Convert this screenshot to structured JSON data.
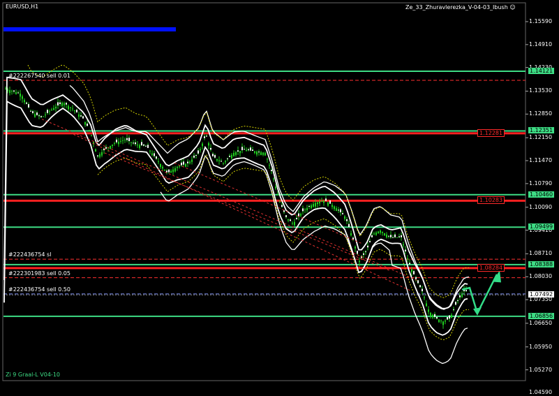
{
  "symbol": "EURUSD,H1",
  "indicator": "Ze_33_Zhuravlerezka_V-04-03_Ibush",
  "footer_label": "Zi 9 Graal-L  V04-10",
  "order_labels": [
    {
      "text": "#222267540 sell 0.01",
      "level": 1.1385
    },
    {
      "text": "#222436754 sl",
      "level": 1.0855
    },
    {
      "text": "#222301983 sell 0.05",
      "level": 1.08
    },
    {
      "text": "#222436754 sell 0.50",
      "level": 1.0752
    }
  ],
  "axis": {
    "min": 1.0495,
    "max": 1.159,
    "ticks": [
      "1.15590",
      "1.14910",
      "1.14230",
      "1.13530",
      "1.12850",
      "1.12150",
      "1.11470",
      "1.10790",
      "1.10090",
      "1.09410",
      "1.08710",
      "1.08030",
      "1.07350",
      "1.06650",
      "1.05950",
      "1.05270",
      "1.04590"
    ],
    "tick_values": [
      1.1559,
      1.1491,
      1.1423,
      1.1353,
      1.1285,
      1.1215,
      1.1147,
      1.1079,
      1.1009,
      1.0941,
      1.0871,
      1.0803,
      1.0735,
      1.0665,
      1.0595,
      1.0527,
      1.0459
    ]
  },
  "green_levels": [
    {
      "value": 1.14121,
      "label": "1.14121"
    },
    {
      "value": 1.12351,
      "label": "1.12351"
    },
    {
      "value": 1.1046,
      "label": "1.10460"
    },
    {
      "value": 1.09499,
      "label": "1.09499"
    },
    {
      "value": 1.08388,
      "label": "1.08388"
    },
    {
      "value": 1.06856,
      "label": "1.06856"
    }
  ],
  "red_levels": [
    {
      "value": 1.12281,
      "label": "1.12281"
    },
    {
      "value": 1.10283,
      "label": "1.10283"
    },
    {
      "value": 1.08284,
      "label": "1.08284"
    }
  ],
  "current_price": {
    "value": 1.07492,
    "label": "1.07492"
  },
  "colors": {
    "background": "#000000",
    "green_line": "#3ddc84",
    "red_line": "#ff2020",
    "bull_candle": "#1fd01f",
    "band": "#ffffff",
    "ma": "#d4d400",
    "blue_bar": "#0010ff",
    "arrow": "#33dd88"
  }
}
